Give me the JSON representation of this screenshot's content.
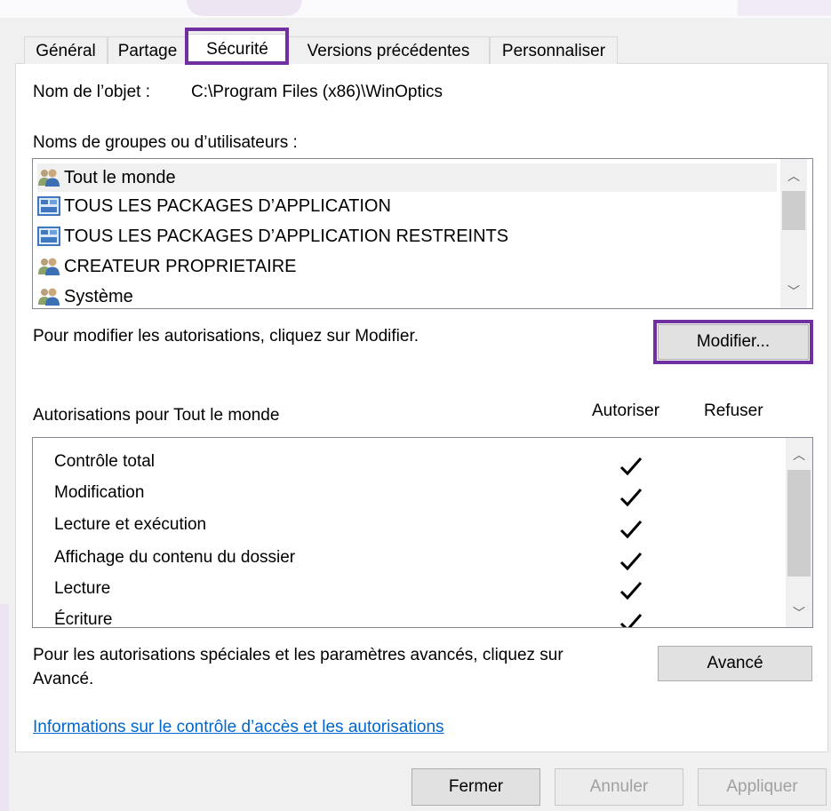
{
  "tabs": [
    {
      "label": "Général"
    },
    {
      "label": "Partage"
    },
    {
      "label": "Sécurité"
    },
    {
      "label": "Versions précédentes"
    },
    {
      "label": "Personnaliser"
    }
  ],
  "object": {
    "label": "Nom de l’objet :",
    "path": "C:\\Program Files (x86)\\WinOptics"
  },
  "groups": {
    "label": "Noms de groupes ou d’utilisateurs :",
    "items": [
      {
        "name": "Tout le monde",
        "icon": "users-icon"
      },
      {
        "name": "TOUS LES PACKAGES D’APPLICATION",
        "icon": "app-package-icon"
      },
      {
        "name": "TOUS LES PACKAGES D’APPLICATION RESTREINTS",
        "icon": "app-package-icon"
      },
      {
        "name": "CREATEUR PROPRIETAIRE",
        "icon": "users-icon"
      },
      {
        "name": "Système",
        "icon": "users-icon"
      }
    ]
  },
  "modify": {
    "hint": "Pour modifier les autorisations, cliquez sur Modifier.",
    "button": "Modifier..."
  },
  "permissions": {
    "label": "Autorisations pour Tout le monde",
    "allow_header": "Autoriser",
    "deny_header": "Refuser",
    "items": [
      {
        "name": "Contrôle total",
        "allow": true,
        "deny": false
      },
      {
        "name": "Modification",
        "allow": true,
        "deny": false
      },
      {
        "name": "Lecture et exécution",
        "allow": true,
        "deny": false
      },
      {
        "name": "Affichage du contenu du dossier",
        "allow": true,
        "deny": false
      },
      {
        "name": "Lecture",
        "allow": true,
        "deny": false
      },
      {
        "name": "Écriture",
        "allow": true,
        "deny": false
      }
    ]
  },
  "advanced": {
    "hint_line1": "Pour les autorisations spéciales et les paramètres avancés, cliquez sur",
    "hint_line2": "Avancé.",
    "button": "Avancé"
  },
  "info_link": "Informations sur le contrôle d’accès et les autorisations",
  "footer": {
    "close": "Fermer",
    "cancel": "Annuler",
    "apply": "Appliquer"
  },
  "colors": {
    "highlight": "#7030a0",
    "link": "#0066cc"
  }
}
